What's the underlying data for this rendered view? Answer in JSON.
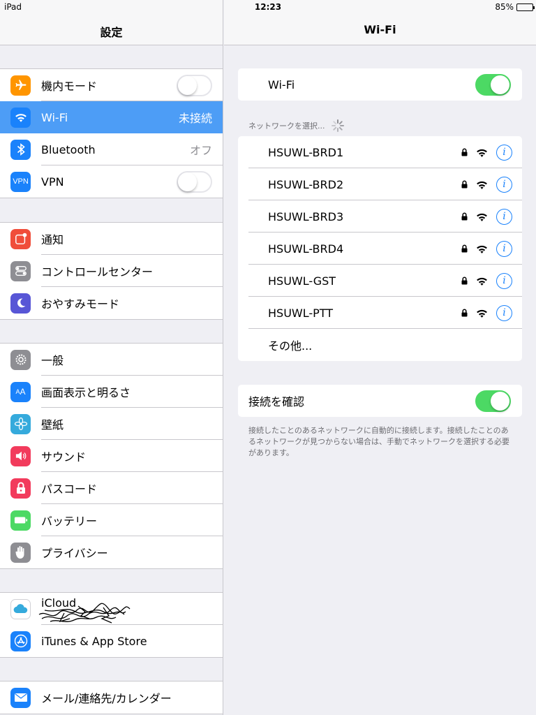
{
  "status": {
    "device": "iPad",
    "time": "12:23",
    "battery": "85%",
    "battery_level": 0.85
  },
  "master": {
    "title": "設定",
    "groups": [
      {
        "items": [
          {
            "label": "機内モード",
            "icon": "airplane-icon",
            "color": "#ff9500",
            "toggle": false
          },
          {
            "label": "Wi-Fi",
            "icon": "wifi-icon",
            "color": "#1a82fb",
            "detail": "未接続",
            "selected": true
          },
          {
            "label": "Bluetooth",
            "icon": "bluetooth-icon",
            "color": "#1a82fb",
            "detail": "オフ"
          },
          {
            "label": "VPN",
            "icon": "vpn-icon",
            "color": "#1a82fb",
            "toggle": false
          }
        ]
      },
      {
        "items": [
          {
            "label": "通知",
            "icon": "notifications-icon",
            "color": "#f04d3a"
          },
          {
            "label": "コントロールセンター",
            "icon": "control-center-icon",
            "color": "#8e8e93"
          },
          {
            "label": "おやすみモード",
            "icon": "moon-icon",
            "color": "#5856d6"
          }
        ]
      },
      {
        "items": [
          {
            "label": "一般",
            "icon": "gear-icon",
            "color": "#8e8e93"
          },
          {
            "label": "画面表示と明るさ",
            "icon": "display-icon",
            "color": "#1a82fb"
          },
          {
            "label": "壁紙",
            "icon": "wallpaper-icon",
            "color": "#35aadc"
          },
          {
            "label": "サウンド",
            "icon": "sound-icon",
            "color": "#f23b5c"
          },
          {
            "label": "パスコード",
            "icon": "passcode-icon",
            "color": "#f23b5c"
          },
          {
            "label": "バッテリー",
            "icon": "battery-icon",
            "color": "#4cd964"
          },
          {
            "label": "プライバシー",
            "icon": "privacy-hand-icon",
            "color": "#8e8e93"
          }
        ]
      },
      {
        "items": [
          {
            "label": "iCloud",
            "icon": "icloud-icon",
            "color": "#ffffff"
          },
          {
            "label": "iTunes & App Store",
            "icon": "app-store-icon",
            "color": "#1a82fb"
          }
        ]
      },
      {
        "items": [
          {
            "label": "メール/連絡先/カレンダー",
            "icon": "mail-icon",
            "color": "#1a82fb"
          }
        ]
      }
    ]
  },
  "detail": {
    "title": "Wi-Fi",
    "wifi": {
      "label": "Wi-Fi",
      "on": true
    },
    "networks_header": "ネットワークを選択...",
    "networks": [
      {
        "name": "HSUWL-BRD1",
        "locked": true
      },
      {
        "name": "HSUWL-BRD2",
        "locked": true
      },
      {
        "name": "HSUWL-BRD3",
        "locked": true
      },
      {
        "name": "HSUWL-BRD4",
        "locked": true
      },
      {
        "name": "HSUWL-GST",
        "locked": true
      },
      {
        "name": "HSUWL-PTT",
        "locked": true
      }
    ],
    "other": "その他...",
    "ask": {
      "label": "接続を確認",
      "on": true
    },
    "footnote": "接続したことのあるネットワークに自動的に接続します。接続したことのあるネットワークが見つからない場合は、手動でネットワークを選択する必要があります。"
  },
  "colors": {
    "accent": "#1a82fb",
    "switch_on": "#4cd964",
    "selection": "#4d9df6"
  }
}
